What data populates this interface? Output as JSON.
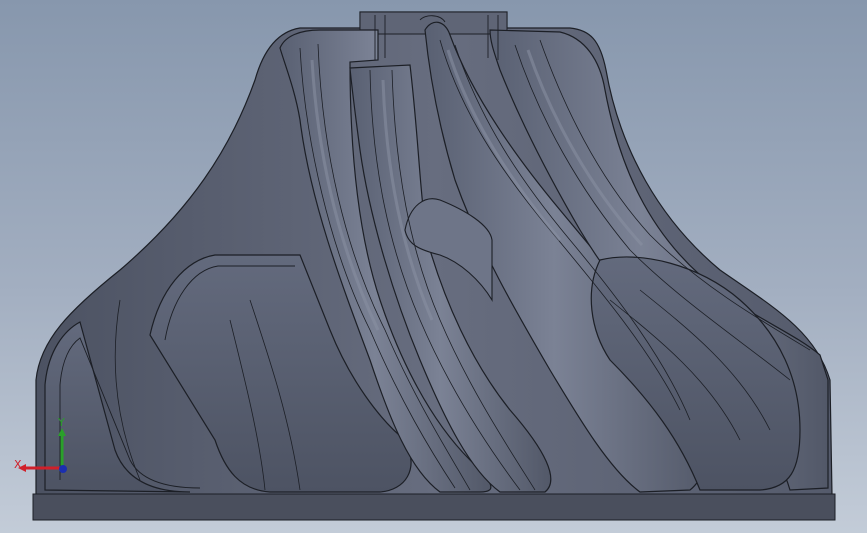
{
  "viewport": {
    "background_top": "#8797ad",
    "background_bottom": "#c3ccd8"
  },
  "model": {
    "body_color": "#5b6172",
    "edge_color": "#1c1f26",
    "highlight_color": "#8a91a3"
  },
  "triad": {
    "x_label": "X",
    "y_label": "Y",
    "x_color": "#d0202a",
    "y_color": "#2aa02a",
    "z_color": "#1b2fb0"
  }
}
